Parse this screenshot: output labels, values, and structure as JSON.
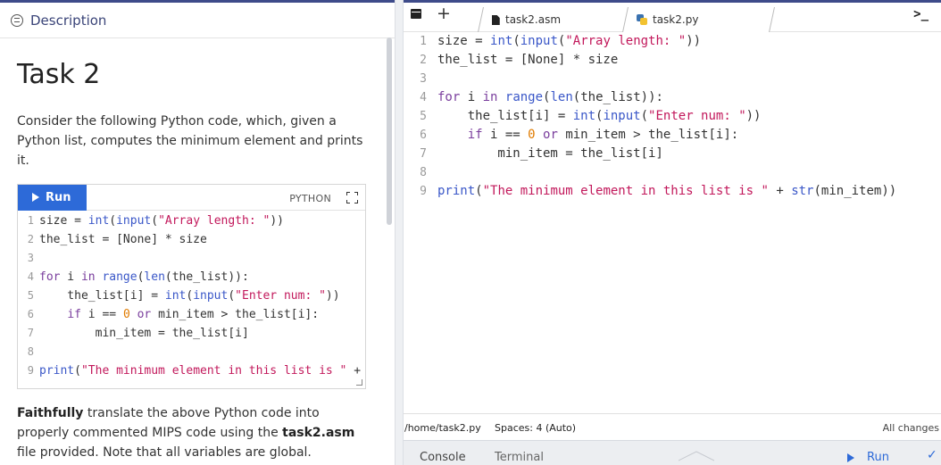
{
  "description_tab": {
    "label": "Description"
  },
  "task": {
    "title": "Task 2",
    "intro": "Consider the following Python code, which, given a Python list, computes the minimum element and prints it.",
    "instruction": {
      "part1_bold": "Faithfully",
      "part2": " translate the above Python code into properly commented MIPS code using the ",
      "part3_bold": "task2.asm",
      "part4": " file provided. Note that all variables are global."
    }
  },
  "code_card": {
    "run_label": "Run",
    "language": "PYTHON"
  },
  "code_lines": [
    {
      "n": "1",
      "segs": [
        [
          "tx",
          "size = "
        ],
        [
          "fn",
          "int"
        ],
        [
          "tx",
          "("
        ],
        [
          "fn",
          "input"
        ],
        [
          "tx",
          "("
        ],
        [
          "st",
          "\"Array length: \""
        ],
        [
          "tx",
          "))"
        ]
      ]
    },
    {
      "n": "2",
      "segs": [
        [
          "tx",
          "the_list = [None] * size"
        ]
      ]
    },
    {
      "n": "3",
      "segs": []
    },
    {
      "n": "4",
      "segs": [
        [
          "kw",
          "for"
        ],
        [
          "tx",
          " i "
        ],
        [
          "kw",
          "in"
        ],
        [
          "tx",
          " "
        ],
        [
          "fn",
          "range"
        ],
        [
          "tx",
          "("
        ],
        [
          "fn",
          "len"
        ],
        [
          "tx",
          "(the_list)):"
        ]
      ]
    },
    {
      "n": "5",
      "segs": [
        [
          "tx",
          "    the_list[i] = "
        ],
        [
          "fn",
          "int"
        ],
        [
          "tx",
          "("
        ],
        [
          "fn",
          "input"
        ],
        [
          "tx",
          "("
        ],
        [
          "st",
          "\"Enter num: \""
        ],
        [
          "tx",
          "))"
        ]
      ]
    },
    {
      "n": "6",
      "segs": [
        [
          "tx",
          "    "
        ],
        [
          "kw",
          "if"
        ],
        [
          "tx",
          " i == "
        ],
        [
          "nm",
          "0"
        ],
        [
          "tx",
          " "
        ],
        [
          "kw",
          "or"
        ],
        [
          "tx",
          " min_item > the_list[i]:"
        ]
      ]
    },
    {
      "n": "7",
      "segs": [
        [
          "tx",
          "        min_item = the_list[i]"
        ]
      ]
    },
    {
      "n": "8",
      "segs": []
    },
    {
      "n": "9",
      "segs": [
        [
          "fn",
          "print"
        ],
        [
          "tx",
          "("
        ],
        [
          "st",
          "\"The minimum element in this list is \""
        ],
        [
          "tx",
          " + "
        ],
        [
          "fn",
          "str"
        ],
        [
          "tx",
          "(min_item))"
        ]
      ]
    }
  ],
  "editor": {
    "tabs": [
      {
        "label": "task2.asm",
        "icon": "file-icon"
      },
      {
        "label": "task2.py",
        "icon": "python-icon"
      }
    ],
    "terminal_glyph": ">_"
  },
  "status": {
    "path": "/home/task2.py",
    "spaces": "Spaces: 4 (Auto)",
    "saved": "All changes"
  },
  "bottom": {
    "console": "Console",
    "terminal": "Terminal",
    "run": "Run",
    "check": "✓"
  }
}
